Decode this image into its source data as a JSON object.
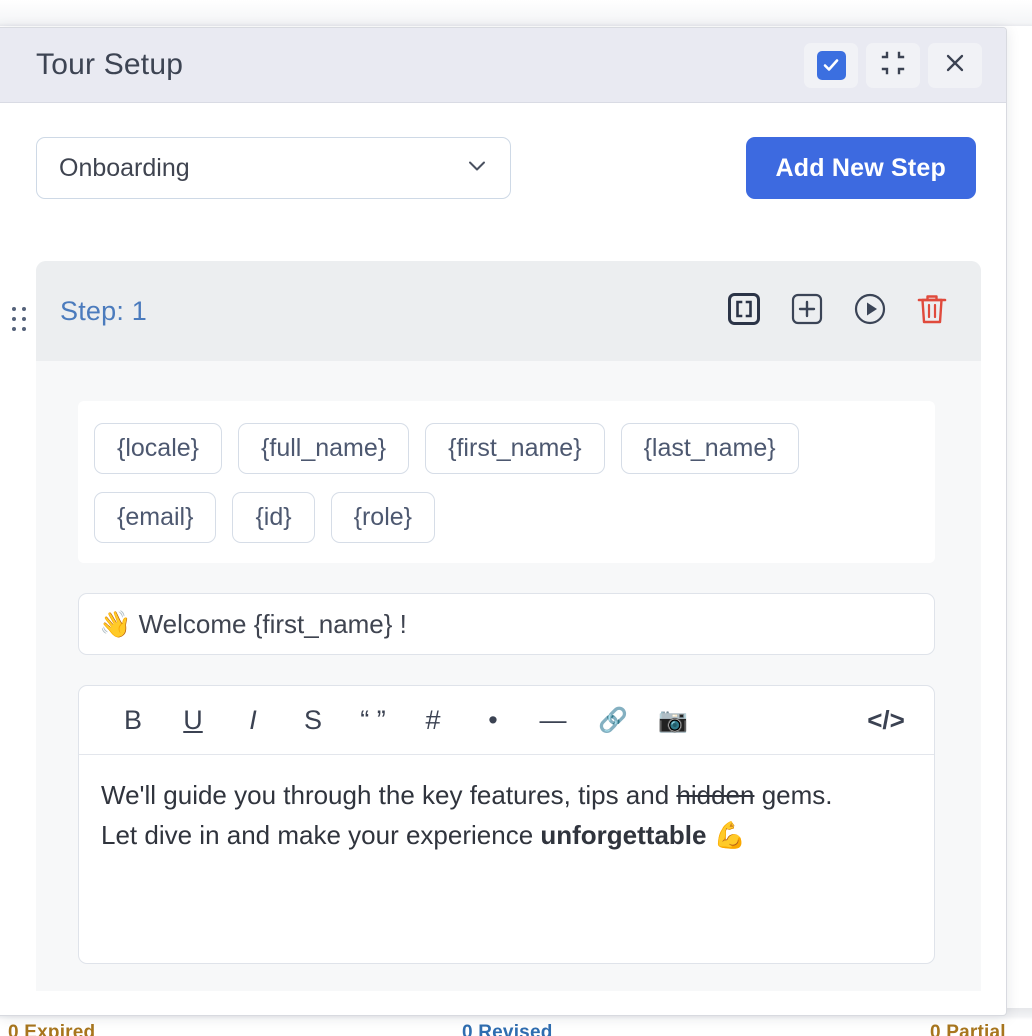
{
  "background": {
    "status_bar": {
      "expired": "0 Expired",
      "revised": "0 Revised",
      "partial": "0 Partial"
    }
  },
  "modal": {
    "title": "Tour Setup",
    "header_actions": [
      {
        "name": "confirm-checkbox",
        "label": "",
        "icon": "checkbox-checked-icon",
        "state": "checked",
        "color": "#3b6fe0"
      },
      {
        "name": "collapse-button",
        "label": "",
        "icon": "collapse-icon"
      },
      {
        "name": "close-button",
        "label": "",
        "icon": "close-icon"
      }
    ],
    "toolbar": {
      "tour_select": {
        "value": "Onboarding",
        "options": [
          "Onboarding"
        ]
      },
      "add_step_label": "Add New Step",
      "add_step_color": "#3d6ae0"
    },
    "step": {
      "label": "Step: 1",
      "label_color": "#4b7bbd",
      "actions": [
        {
          "name": "brackets-button",
          "icon": "brackets-icon"
        },
        {
          "name": "add-button",
          "icon": "plus-square-icon"
        },
        {
          "name": "preview-button",
          "icon": "play-circle-icon"
        },
        {
          "name": "delete-button",
          "icon": "trash-icon",
          "color": "#e04a3c"
        }
      ],
      "variables": [
        [
          "{locale}",
          "{full_name}",
          "{first_name}",
          "{last_name}"
        ],
        [
          "{email}",
          "{id}",
          "{role}"
        ]
      ],
      "title_value": "👋 Welcome {first_name} !",
      "editor": {
        "toolbar": [
          {
            "name": "bold-button",
            "label": "B",
            "icon": "bold-icon"
          },
          {
            "name": "underline-button",
            "label": "U",
            "icon": "underline-icon"
          },
          {
            "name": "italic-button",
            "label": "I",
            "icon": "italic-icon"
          },
          {
            "name": "strikethrough-button",
            "label": "S",
            "icon": "strikethrough-icon"
          },
          {
            "name": "quote-button",
            "label": "“ ”",
            "icon": "quote-icon"
          },
          {
            "name": "heading-button",
            "label": "#",
            "icon": "hash-icon"
          },
          {
            "name": "bullet-list-button",
            "label": "•",
            "icon": "bullet-icon"
          },
          {
            "name": "horizontal-rule-button",
            "label": "—",
            "icon": "horizontal-rule-icon"
          },
          {
            "name": "link-button",
            "label": "🔗",
            "icon": "link-icon"
          },
          {
            "name": "image-button",
            "label": "📷",
            "icon": "camera-icon"
          },
          {
            "name": "code-view-button",
            "label": "</>",
            "icon": "code-icon"
          }
        ],
        "content": {
          "line1_a": "We'll guide you through the key features, tips and ",
          "line1_strike": "hidden",
          "line1_b": " gems.",
          "line2_a": "Let dive in and make your experience ",
          "line2_bold": "unforgettable",
          "line2_c": " 💪"
        }
      }
    }
  }
}
